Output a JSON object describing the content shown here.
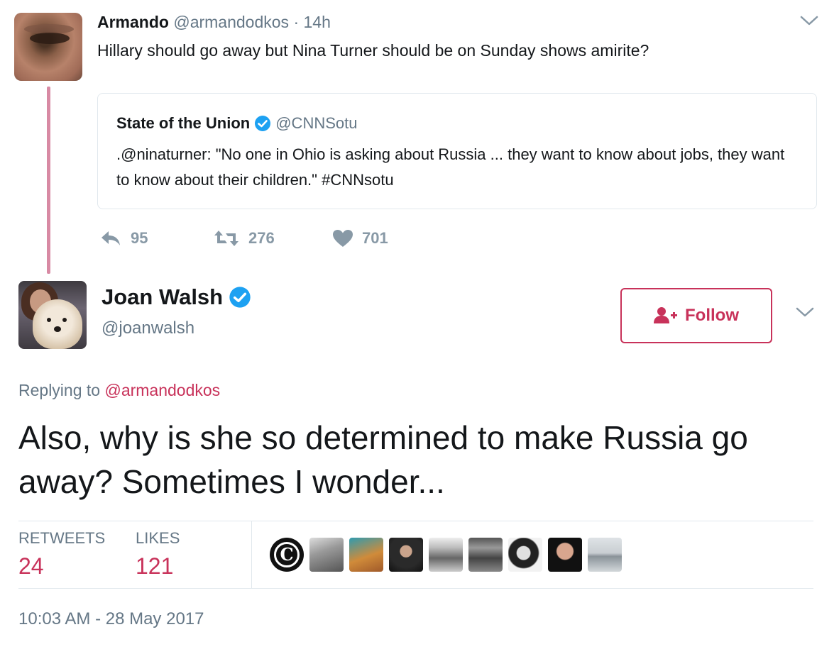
{
  "parent_tweet": {
    "author_name": "Armando",
    "handle": "@armandodkos",
    "separator": "·",
    "time": "14h",
    "text": "Hillary should go away but Nina Turner should be on Sunday shows amirite?",
    "quoted_tweet": {
      "author_name": "State of the Union",
      "handle": "@CNNSotu",
      "text": ".@ninaturner: \"No one in Ohio is asking about Russia ... they want to know about jobs, they want to know about their children.\" #CNNsotu"
    },
    "actions": {
      "replies": "95",
      "retweets": "276",
      "likes": "701"
    }
  },
  "main_tweet": {
    "author_name": "Joan Walsh",
    "handle": "@joanwalsh",
    "follow_label": "Follow",
    "replying_prefix": "Replying to",
    "replying_mention": "@armandodkos",
    "text": "Also, why is she so determined to make Russia go away? Sometimes I wonder...",
    "stats": {
      "retweets_label": "RETWEETS",
      "retweets_value": "24",
      "likes_label": "LIKES",
      "likes_value": "121"
    },
    "liker_initial": "C",
    "timestamp": "10:03 AM - 28 May 2017"
  },
  "icons": [
    "chevron-down-icon",
    "verified-badge-icon",
    "reply-icon",
    "retweet-icon",
    "heart-icon",
    "follow-person-icon"
  ],
  "colors": {
    "accent": "#c8325a",
    "thread_line": "#d88aa4",
    "muted": "#657786",
    "action_gray": "#8899a6",
    "verified_blue": "#1da1f2"
  }
}
